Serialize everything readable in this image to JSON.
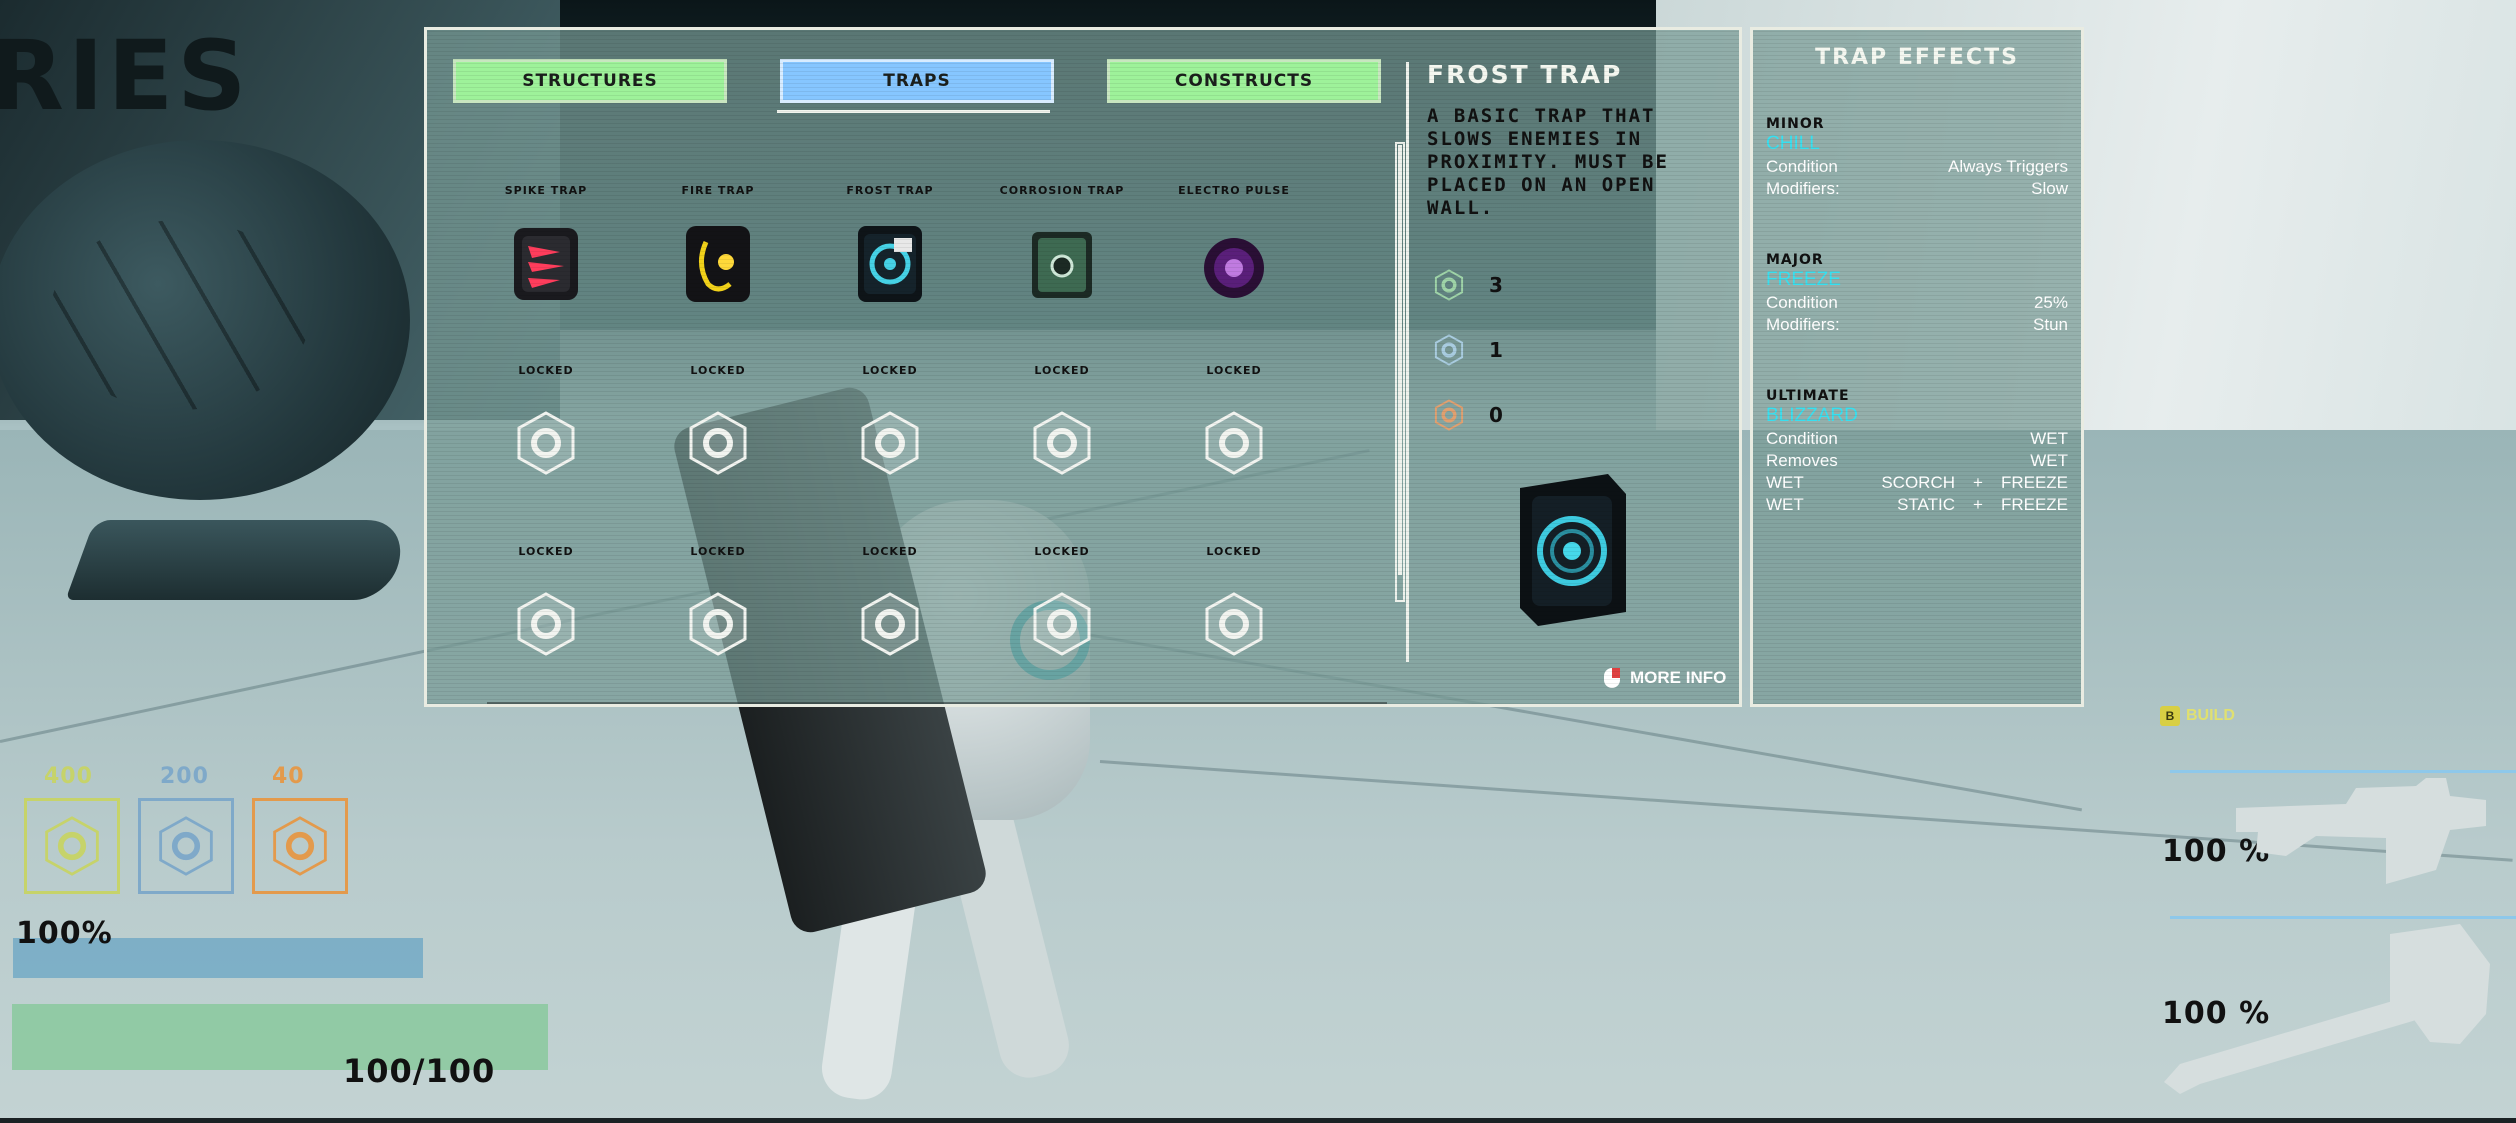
{
  "background": {
    "wall_text": "RIES"
  },
  "tabs": [
    {
      "label": "STRUCTURES",
      "active": false
    },
    {
      "label": "TRAPS",
      "active": true
    },
    {
      "label": "CONSTRUCTS",
      "active": false
    }
  ],
  "grid": {
    "row1": [
      {
        "label": "SPIKE TRAP",
        "icon": "spike-trap-icon"
      },
      {
        "label": "FIRE TRAP",
        "icon": "fire-trap-icon"
      },
      {
        "label": "FROST TRAP",
        "icon": "frost-trap-icon",
        "selected": true
      },
      {
        "label": "CORROSION TRAP",
        "icon": "corrosion-trap-icon"
      },
      {
        "label": "ELECTRO PULSE",
        "icon": "electro-pulse-icon"
      }
    ],
    "locked_label": "LOCKED"
  },
  "detail": {
    "title": "FROST TRAP",
    "description": "A BASIC TRAP THAT SLOWS ENEMIES IN PROXIMITY. MUST BE PLACED ON AN OPEN WALL.",
    "costs": [
      {
        "icon": "green-hex-nut-icon",
        "value": "3",
        "color": "#9fd4a8"
      },
      {
        "icon": "blue-hex-nut-icon",
        "value": "1",
        "color": "#a9cce0"
      },
      {
        "icon": "orange-hex-nut-icon",
        "value": "0",
        "color": "#e0a070"
      }
    ],
    "more_info": "MORE INFO"
  },
  "effects": {
    "title": "TRAP EFFECTS",
    "minor": {
      "tier": "MINOR",
      "name": "CHILL",
      "rows": [
        {
          "k": "Condition",
          "v": "Always Triggers"
        },
        {
          "k": "Modifiers:",
          "v": "Slow"
        }
      ]
    },
    "major": {
      "tier": "MAJOR",
      "name": "FREEZE",
      "rows": [
        {
          "k": "Condition",
          "v": "25%"
        },
        {
          "k": "Modifiers:",
          "v": "Stun"
        }
      ]
    },
    "ultimate": {
      "tier": "ULTIMATE",
      "name": "BLIZZARD",
      "rows": [
        {
          "k": "Condition",
          "v": "WET"
        },
        {
          "k": "Removes",
          "v": "WET"
        }
      ],
      "combos": [
        {
          "k": "WET",
          "a": "SCORCH",
          "op": "+",
          "b": "FREEZE"
        },
        {
          "k": "WET",
          "a": "STATIC",
          "op": "+",
          "b": "FREEZE"
        }
      ]
    }
  },
  "hud": {
    "resources": [
      {
        "value": "400",
        "color": "#c6d36a"
      },
      {
        "value": "200",
        "color": "#7fa9c9"
      },
      {
        "value": "40",
        "color": "#e39a4c"
      }
    ],
    "shield_pct": "100%",
    "health": "100/100",
    "build": {
      "key": "B",
      "label": "BUILD"
    },
    "weapon1_pct": "100 %",
    "weapon2_pct": "100 %"
  }
}
